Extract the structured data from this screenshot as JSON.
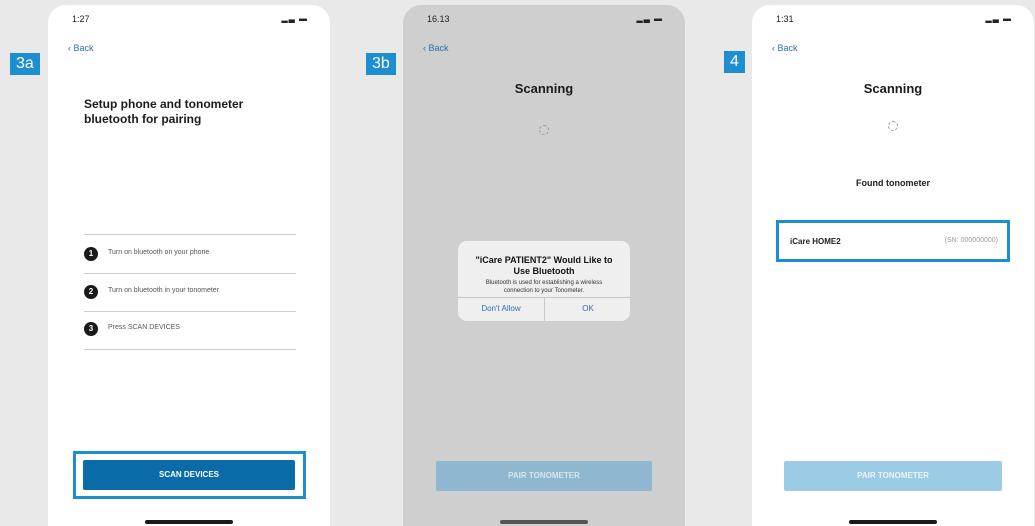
{
  "steps": [
    "3a",
    "3b",
    "4"
  ],
  "phone1": {
    "time": "1:27",
    "back": "Back",
    "title": "Setup phone and tonometer bluetooth for pairing",
    "instructions": [
      {
        "num": "1",
        "text": "Turn on bluetooth on your phone"
      },
      {
        "num": "2",
        "text": "Turn on bluetooth in your tonometer"
      },
      {
        "num": "3",
        "text": "Press SCAN DEVICES"
      }
    ],
    "button": "SCAN DEVICES",
    "button_color": "#0b6aa8"
  },
  "phone2": {
    "time": "16.13",
    "back": "Back",
    "title": "Scanning",
    "alert": {
      "title": "\"iCare PATIENT2\" Would Like to Use Bluetooth",
      "message": "Bluetooth is used for establishing a wireless connection to your Tonometer.",
      "deny": "Don't Allow",
      "ok": "OK"
    },
    "button": "PAIR TONOMETER"
  },
  "phone3": {
    "time": "1:31",
    "back": "Back",
    "title": "Scanning",
    "found_label": "Found tonometer",
    "device_name": "iCare HOME2",
    "device_sn": "(SN: 000000000)",
    "button": "PAIR TONOMETER"
  },
  "colors": {
    "accent": "#1d8fd0",
    "button_disabled": "#9ccbe6"
  },
  "icons": {
    "back": "chevron-left-icon",
    "signal": "signal-wifi-battery-icon"
  }
}
